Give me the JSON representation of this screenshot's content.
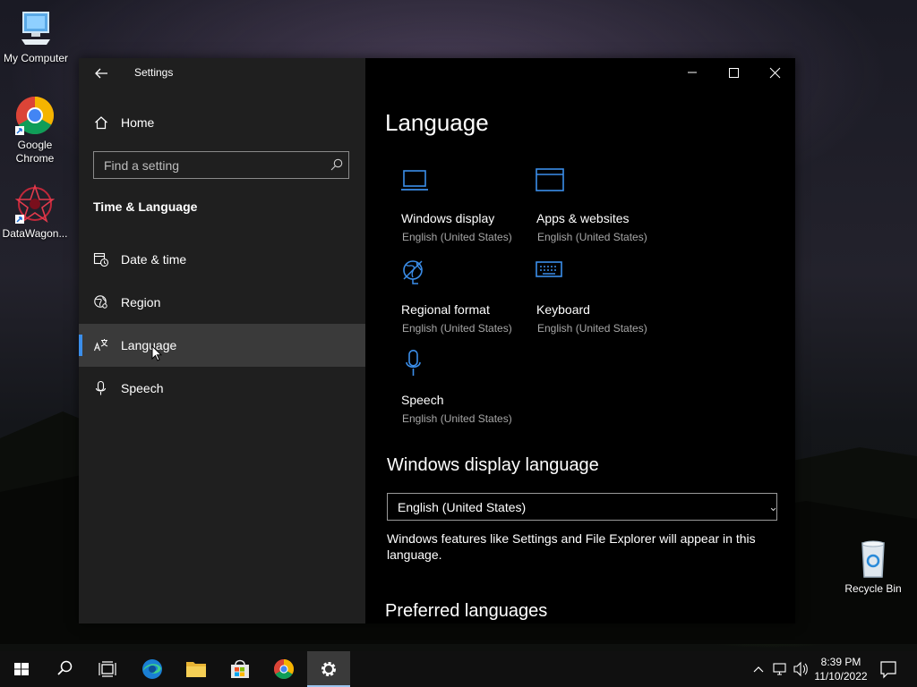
{
  "desktop": {
    "icons": [
      {
        "label": "My Computer",
        "icon": "computer-icon"
      },
      {
        "label": "Google Chrome",
        "icon": "chrome-icon"
      },
      {
        "label": "DataWagon...",
        "icon": "datawagon-icon"
      },
      {
        "label": "Recycle Bin",
        "icon": "recycle-bin-icon"
      }
    ]
  },
  "window": {
    "title": "Settings",
    "controls": [
      "minimize",
      "maximize",
      "close"
    ]
  },
  "sidebar": {
    "home_label": "Home",
    "search_placeholder": "Find a setting",
    "section_heading": "Time & Language",
    "items": [
      {
        "label": "Date & time",
        "icon": "calendar-clock-icon"
      },
      {
        "label": "Region",
        "icon": "globe-icon"
      },
      {
        "label": "Language",
        "icon": "language-icon",
        "selected": true
      },
      {
        "label": "Speech",
        "icon": "microphone-icon"
      }
    ]
  },
  "main": {
    "title": "Language",
    "tiles": [
      {
        "name": "Windows display",
        "sub": "English (United States)",
        "icon": "laptop-icon"
      },
      {
        "name": "Apps & websites",
        "sub": "English (United States)",
        "icon": "window-icon"
      },
      {
        "name": "Regional format",
        "sub": "English (United States)",
        "icon": "regional-format-icon"
      },
      {
        "name": "Keyboard",
        "sub": "English (United States)",
        "icon": "keyboard-icon"
      },
      {
        "name": "Speech",
        "sub": "English (United States)",
        "icon": "microphone-icon"
      }
    ],
    "display_language_heading": "Windows display language",
    "display_language_value": "English (United States)",
    "display_language_desc": "Windows features like Settings and File Explorer will appear in this language.",
    "preferred_heading": "Preferred languages"
  },
  "taskbar": {
    "apps": [
      "start",
      "search",
      "task-view",
      "edge",
      "file-explorer",
      "store",
      "chrome",
      "settings"
    ],
    "active_app": "settings",
    "time": "8:39 PM",
    "date": "11/10/2022"
  },
  "colors": {
    "accent": "#3b8eea",
    "sidebar_bg": "#1f1f1f",
    "selected_bg": "#3a3a3a"
  }
}
